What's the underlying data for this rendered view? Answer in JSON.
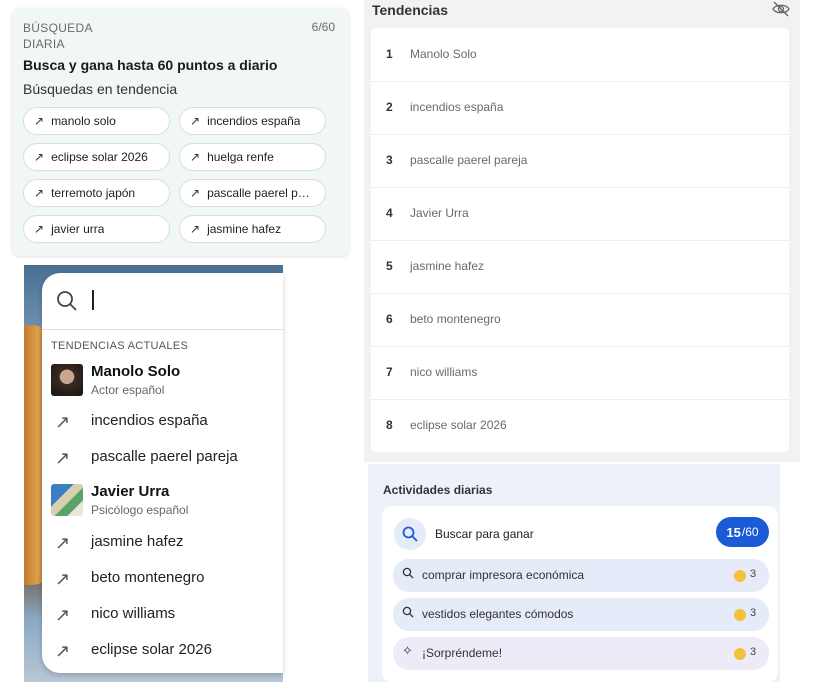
{
  "daily": {
    "label_line1": "BÚSQUEDA",
    "label_line2": "DIARIA",
    "progress": "6/60",
    "title": "Busca y gana hasta 60 puntos a diario",
    "subtitle": "Búsquedas en tendencia",
    "chips": [
      "manolo solo",
      "incendios españa",
      "eclipse solar 2026",
      "huelga renfe",
      "terremoto japón",
      "pascalle paerel par...",
      "javier urra",
      "jasmine hafez"
    ]
  },
  "dropdown": {
    "header": "TENDENCIAS ACTUALES",
    "items": [
      {
        "kind": "person",
        "title": "Manolo Solo",
        "subtitle": "Actor español"
      },
      {
        "kind": "trend",
        "title": "incendios españa"
      },
      {
        "kind": "trend",
        "title": "pascalle paerel pareja"
      },
      {
        "kind": "person",
        "title": "Javier Urra",
        "subtitle": "Psicólogo español"
      },
      {
        "kind": "trend",
        "title": "jasmine hafez"
      },
      {
        "kind": "trend",
        "title": "beto montenegro"
      },
      {
        "kind": "trend",
        "title": "nico williams"
      },
      {
        "kind": "trend",
        "title": "eclipse solar 2026"
      }
    ]
  },
  "trends": {
    "title": "Tendencias",
    "items": [
      {
        "rank": "1",
        "label": "Manolo Solo"
      },
      {
        "rank": "2",
        "label": "incendios españa"
      },
      {
        "rank": "3",
        "label": "pascalle paerel pareja"
      },
      {
        "rank": "4",
        "label": "Javier Urra"
      },
      {
        "rank": "5",
        "label": "jasmine hafez"
      },
      {
        "rank": "6",
        "label": "beto montenegro"
      },
      {
        "rank": "7",
        "label": "nico williams"
      },
      {
        "rank": "8",
        "label": "eclipse solar 2026"
      }
    ]
  },
  "activities": {
    "title": "Actividades diarias",
    "search_label": "Buscar para ganar",
    "score": "15",
    "score_max": "/60",
    "items": [
      {
        "icon": "search-icon",
        "label": "comprar impresora económica",
        "points": "3"
      },
      {
        "icon": "search-icon",
        "label": "vestidos elegantes cómodos",
        "points": "3"
      },
      {
        "icon": "sparkle-icon",
        "label": "¡Sorpréndeme!",
        "points": "3"
      }
    ]
  },
  "colors": {
    "accent": "#1c5bd6",
    "coin": "#f3c23a",
    "chip_bg": "#e5ebf9"
  }
}
